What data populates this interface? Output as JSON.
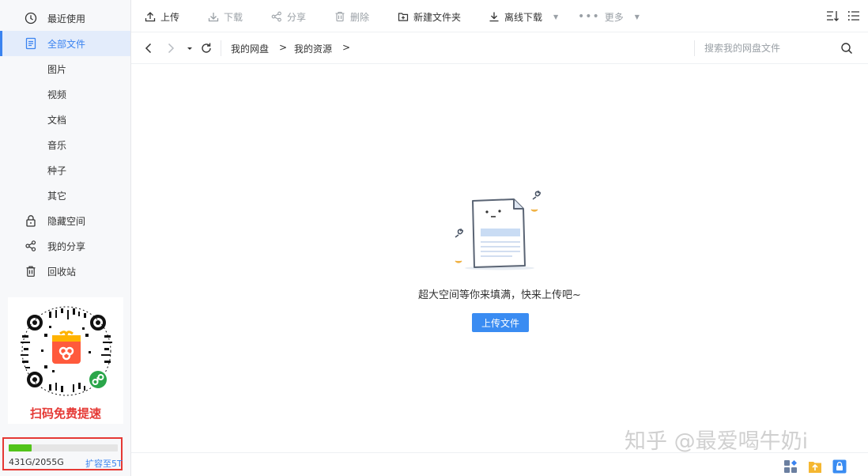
{
  "sidebar": {
    "items": [
      {
        "label": "最近使用",
        "icon": "clock-icon"
      },
      {
        "label": "全部文件",
        "icon": "document-icon",
        "active": true
      },
      {
        "label": "隐藏空间",
        "icon": "lock-icon"
      },
      {
        "label": "我的分享",
        "icon": "share-icon"
      },
      {
        "label": "回收站",
        "icon": "trash-icon"
      }
    ],
    "sub_items": [
      "图片",
      "视频",
      "文档",
      "音乐",
      "种子",
      "其它"
    ],
    "promo_text": "扫码免费提速",
    "storage": {
      "used_text": "431G/2055G",
      "used_fraction": 0.21,
      "expand_link": "扩容至5T",
      "bar_color": "#52c41a"
    }
  },
  "toolbar": {
    "upload": "上传",
    "download": "下载",
    "share": "分享",
    "delete": "删除",
    "new_folder": "新建文件夹",
    "offline_download": "离线下载",
    "more": "更多"
  },
  "address": {
    "breadcrumb": [
      "我的网盘",
      "我的资源"
    ],
    "separator": ">",
    "search_placeholder": "搜索我的网盘文件"
  },
  "empty_state": {
    "message": "超大空间等你来填满，快来上传吧~",
    "button": "上传文件"
  },
  "watermark": "知乎 @最爱喝牛奶i",
  "colors": {
    "accent": "#3a83f0",
    "highlight_box": "#e53935",
    "promo_text": "#e53935"
  }
}
